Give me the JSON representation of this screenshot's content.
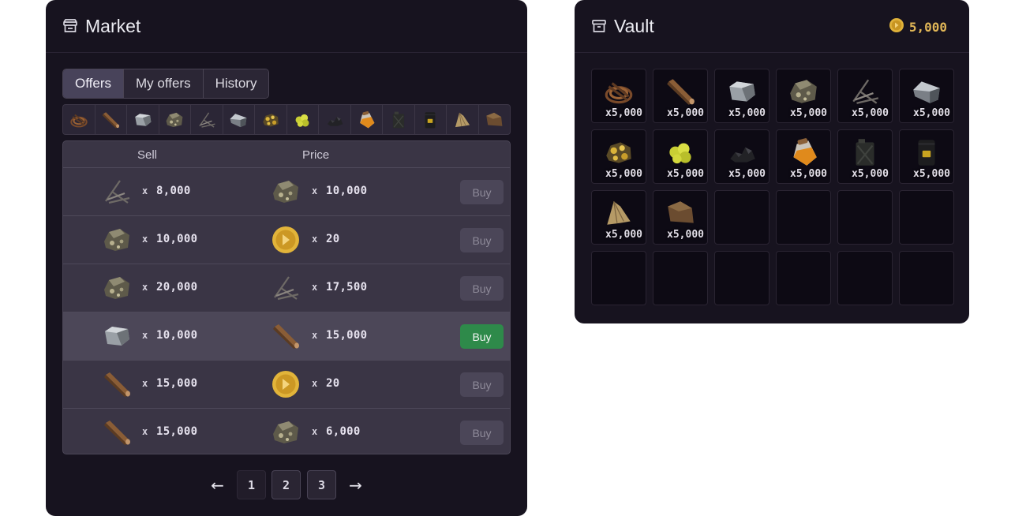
{
  "market": {
    "title": "Market",
    "header_icon": "store-icon",
    "tabs": [
      {
        "label": "Offers",
        "active": true
      },
      {
        "label": "My offers",
        "active": false
      },
      {
        "label": "History",
        "active": false
      }
    ],
    "filters": [
      "rope-icon",
      "plank-icon",
      "stone-icon",
      "ore-icon",
      "sticks-icon",
      "iron-icon",
      "gold-ore-icon",
      "sulfur-icon",
      "coal-icon",
      "oil-jar-icon",
      "jerrycan-icon",
      "barrel-icon",
      "hide-icon",
      "leather-icon"
    ],
    "table": {
      "headers": {
        "sell": "Sell",
        "price": "Price"
      },
      "rows": [
        {
          "sell_icon": "sticks-icon",
          "sell_x": "x",
          "sell_qty": "8,000",
          "price_icon": "ore-icon",
          "price_x": "x",
          "price_qty": "10,000",
          "button": "Buy",
          "active": false
        },
        {
          "sell_icon": "ore-icon",
          "sell_x": "x",
          "sell_qty": "10,000",
          "price_icon": "coin-icon",
          "price_x": "x",
          "price_qty": "20",
          "button": "Buy",
          "active": false
        },
        {
          "sell_icon": "ore-icon",
          "sell_x": "x",
          "sell_qty": "20,000",
          "price_icon": "sticks-icon",
          "price_x": "x",
          "price_qty": "17,500",
          "button": "Buy",
          "active": false
        },
        {
          "sell_icon": "stone-icon",
          "sell_x": "x",
          "sell_qty": "10,000",
          "price_icon": "plank-icon",
          "price_x": "x",
          "price_qty": "15,000",
          "button": "Buy",
          "active": true
        },
        {
          "sell_icon": "plank-icon",
          "sell_x": "x",
          "sell_qty": "15,000",
          "price_icon": "coin-icon",
          "price_x": "x",
          "price_qty": "20",
          "button": "Buy",
          "active": false
        },
        {
          "sell_icon": "plank-icon",
          "sell_x": "x",
          "sell_qty": "15,000",
          "price_icon": "ore-icon",
          "price_x": "x",
          "price_qty": "6,000",
          "button": "Buy",
          "active": false
        }
      ]
    },
    "pagination": {
      "prev": "←",
      "pages": [
        "1",
        "2",
        "3"
      ],
      "next": "→"
    }
  },
  "vault": {
    "title": "Vault",
    "header_icon": "archive-icon",
    "balance": "5,000",
    "balance_icon": "coin-icon",
    "items": [
      {
        "icon": "rope-icon",
        "count": "x5,000"
      },
      {
        "icon": "plank-icon",
        "count": "x5,000"
      },
      {
        "icon": "stone-icon",
        "count": "x5,000"
      },
      {
        "icon": "ore-icon",
        "count": "x5,000"
      },
      {
        "icon": "sticks-icon",
        "count": "x5,000"
      },
      {
        "icon": "iron-icon",
        "count": "x5,000"
      },
      {
        "icon": "gold-ore-icon",
        "count": "x5,000"
      },
      {
        "icon": "sulfur-icon",
        "count": "x5,000"
      },
      {
        "icon": "coal-icon",
        "count": "x5,000"
      },
      {
        "icon": "oil-jar-icon",
        "count": "x5,000"
      },
      {
        "icon": "jerrycan-icon",
        "count": "x5,000"
      },
      {
        "icon": "barrel-icon",
        "count": "x5,000"
      },
      {
        "icon": "hide-icon",
        "count": "x5,000"
      },
      {
        "icon": "leather-icon",
        "count": "x5,000"
      },
      {
        "icon": "",
        "count": ""
      },
      {
        "icon": "",
        "count": ""
      },
      {
        "icon": "",
        "count": ""
      },
      {
        "icon": "",
        "count": ""
      },
      {
        "icon": "",
        "count": ""
      },
      {
        "icon": "",
        "count": ""
      },
      {
        "icon": "",
        "count": ""
      },
      {
        "icon": "",
        "count": ""
      },
      {
        "icon": "",
        "count": ""
      },
      {
        "icon": "",
        "count": ""
      }
    ]
  },
  "colors": {
    "panel_bg": "#17131f",
    "buy_active": "#2e8a4a",
    "coin_gold": "#e0b657"
  }
}
